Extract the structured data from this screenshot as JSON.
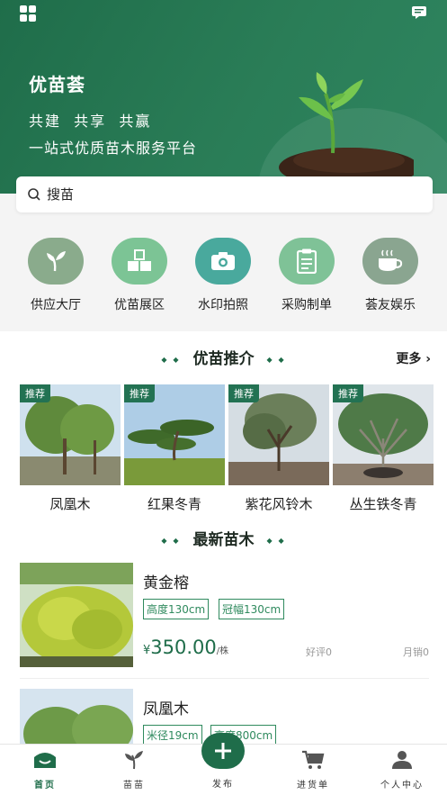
{
  "header": {
    "brand": "优苗荟",
    "slogan1": "共建  共享  共赢",
    "slogan2": "一站式优质苗木服务平台"
  },
  "search": {
    "placeholder": "搜苗"
  },
  "quick_nav": [
    {
      "label": "供应大厅",
      "icon": "sprout-icon",
      "color": "#8aab8c"
    },
    {
      "label": "优苗展区",
      "icon": "blocks-icon",
      "color": "#7cc495"
    },
    {
      "label": "水印拍照",
      "icon": "camera-icon",
      "color": "#49a99d"
    },
    {
      "label": "采购制单",
      "icon": "clipboard-icon",
      "color": "#7fc297"
    },
    {
      "label": "荟友娱乐",
      "icon": "cup-icon",
      "color": "#8aa590"
    }
  ],
  "recommend": {
    "title": "优苗推介",
    "more": "更多",
    "tag": "推荐",
    "items": [
      {
        "name": "凤凰木"
      },
      {
        "name": "红果冬青"
      },
      {
        "name": "紫花风铃木"
      },
      {
        "name": "丛生铁冬青"
      }
    ]
  },
  "latest": {
    "title": "最新苗木",
    "items": [
      {
        "name": "黄金榕",
        "spec1": "高度130cm",
        "spec2": "冠幅130cm",
        "currency": "¥",
        "price": "350.00",
        "unit": "/株",
        "rating": "好评0",
        "sales": "月销0"
      },
      {
        "name": "凤凰木",
        "spec1": "米径19cm",
        "spec2": "高度800cm"
      }
    ]
  },
  "tabbar": {
    "home": "首页",
    "seedling": "苗苗",
    "publish": "发布",
    "cart": "进货单",
    "profile": "个人中心"
  },
  "colors": {
    "brand_green": "#1f6d4a",
    "accent_green": "#2f8a5e"
  }
}
